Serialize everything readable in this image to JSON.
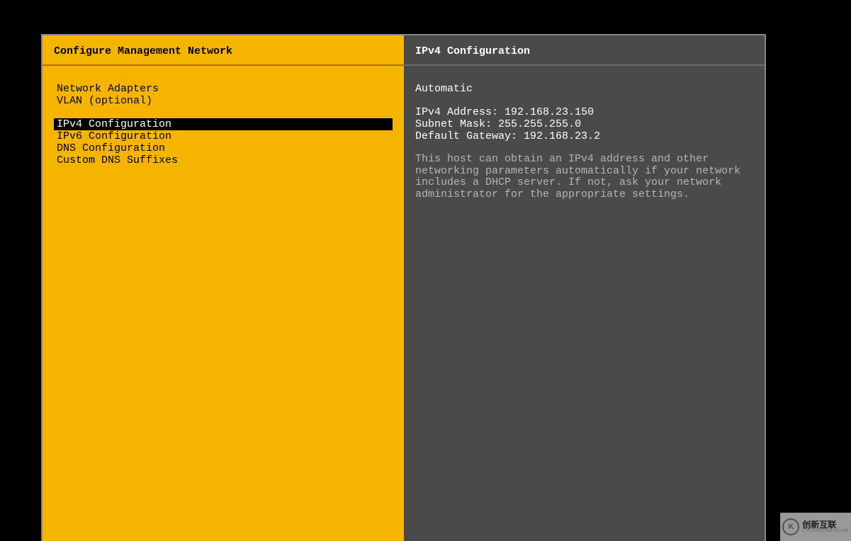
{
  "left": {
    "title": "Configure Management Network",
    "group1": [
      {
        "label": "Network Adapters",
        "selected": false
      },
      {
        "label": "VLAN (optional)",
        "selected": false
      }
    ],
    "group2": [
      {
        "label": "IPv4 Configuration",
        "selected": true
      },
      {
        "label": "IPv6 Configuration",
        "selected": false
      },
      {
        "label": "DNS Configuration",
        "selected": false
      },
      {
        "label": "Custom DNS Suffixes",
        "selected": false
      }
    ]
  },
  "right": {
    "title": "IPv4 Configuration",
    "mode": "Automatic",
    "ipv4_address_label": "IPv4 Address:",
    "ipv4_address_value": "192.168.23.150",
    "subnet_mask_label": "Subnet Mask:",
    "subnet_mask_value": "255.255.255.0",
    "default_gateway_label": "Default Gateway:",
    "default_gateway_value": "192.168.23.2",
    "help_text": "This host can obtain an IPv4 address and other networking parameters automatically if your network includes a DHCP server. If not, ask your network administrator for the appropriate settings."
  },
  "watermark": {
    "main": "创新互联",
    "sub": "CHUANGXINHULIAN"
  }
}
